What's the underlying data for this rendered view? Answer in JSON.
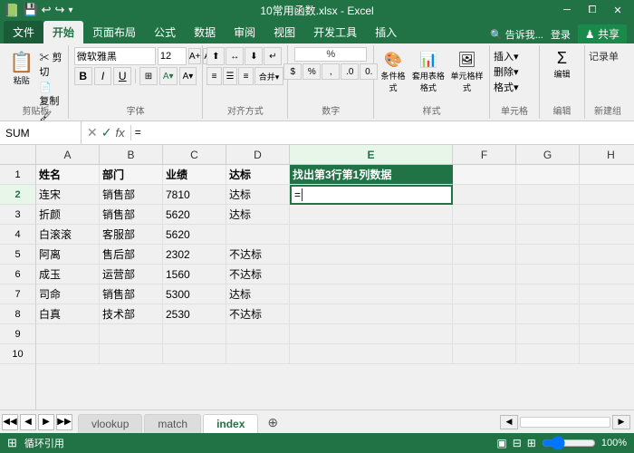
{
  "titleBar": {
    "title": "10常用函数.xlsx - Excel",
    "controls": [
      "minimize",
      "restore",
      "close"
    ]
  },
  "quickAccess": {
    "buttons": [
      "save",
      "undo",
      "redo"
    ]
  },
  "ribbonTabs": {
    "tabs": [
      "文件",
      "开始",
      "页面布局",
      "公式",
      "数据",
      "审阅",
      "视图",
      "开发工具",
      "插入"
    ],
    "activeTab": "开始",
    "rightItems": [
      "告诉我...",
      "登录",
      "共享"
    ]
  },
  "ribbon": {
    "groups": [
      {
        "name": "剪贴板",
        "label": "剪贴板"
      },
      {
        "name": "字体",
        "label": "字体",
        "font": "微软雅黑",
        "size": "12"
      },
      {
        "name": "对齐方式",
        "label": "对齐方式"
      },
      {
        "name": "数字",
        "label": "数字"
      },
      {
        "name": "样式",
        "label": "样式"
      },
      {
        "name": "单元格",
        "label": "单元格"
      },
      {
        "name": "编辑",
        "label": "编辑"
      },
      {
        "name": "新建组",
        "label": "新建组"
      }
    ]
  },
  "formulaBar": {
    "nameBox": "SUM",
    "formula": "=",
    "cursor": true
  },
  "columns": {
    "headers": [
      "A",
      "B",
      "C",
      "D",
      "E",
      "F",
      "G",
      "H"
    ],
    "widths": [
      70,
      70,
      70,
      70,
      180,
      70,
      70,
      70
    ]
  },
  "rows": [
    {
      "num": 1,
      "cells": [
        "姓名",
        "部门",
        "业绩",
        "达标",
        "找出第3行第1列数据",
        "",
        "",
        ""
      ]
    },
    {
      "num": 2,
      "cells": [
        "连宋",
        "销售部",
        "7810",
        "达标",
        "=",
        "",
        "",
        ""
      ]
    },
    {
      "num": 3,
      "cells": [
        "折颜",
        "销售部",
        "5620",
        "达标",
        "",
        "",
        "",
        ""
      ]
    },
    {
      "num": 4,
      "cells": [
        "白滚滚",
        "客服部",
        "5620",
        "",
        "",
        "",
        "",
        ""
      ]
    },
    {
      "num": 5,
      "cells": [
        "阿离",
        "售后部",
        "2302",
        "不达标",
        "",
        "",
        "",
        ""
      ]
    },
    {
      "num": 6,
      "cells": [
        "成玉",
        "运营部",
        "1560",
        "不达标",
        "",
        "",
        "",
        ""
      ]
    },
    {
      "num": 7,
      "cells": [
        "司命",
        "销售部",
        "5300",
        "达标",
        "",
        "",
        "",
        ""
      ]
    },
    {
      "num": 8,
      "cells": [
        "白真",
        "技术部",
        "2530",
        "不达标",
        "",
        "",
        "",
        ""
      ]
    },
    {
      "num": 9,
      "cells": [
        "",
        "",
        "",
        "",
        "",
        "",
        "",
        ""
      ]
    },
    {
      "num": 10,
      "cells": [
        "",
        "",
        "",
        "",
        "",
        "",
        "",
        ""
      ]
    }
  ],
  "sheetTabs": {
    "tabs": [
      "vlookup",
      "match",
      "index"
    ],
    "activeTab": "index",
    "addLabel": "+"
  },
  "statusBar": {
    "mode": "循环引用",
    "readyIcon": "⊞",
    "zoom": "100%",
    "zoomLabel": "100%"
  }
}
